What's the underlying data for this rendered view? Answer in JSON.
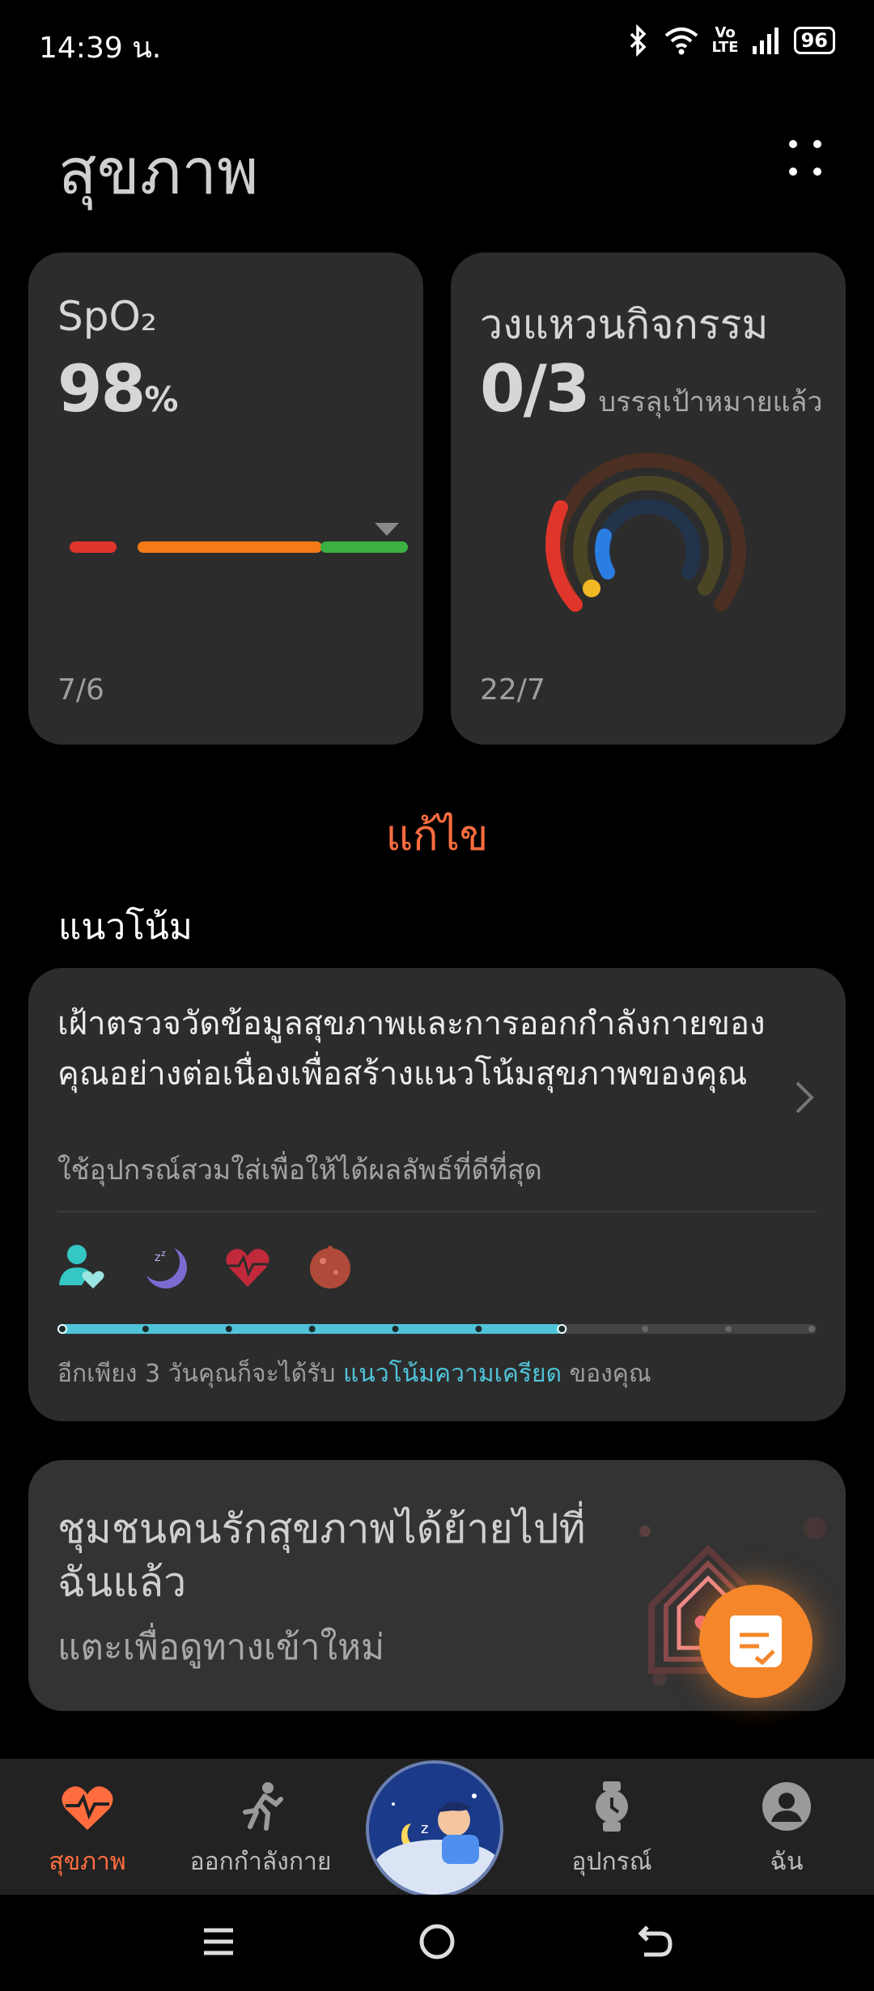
{
  "status": {
    "time": "14:39 น.",
    "battery": "96",
    "volte_top": "Vo",
    "volte_bottom": "LTE"
  },
  "page": {
    "title": "สุขภาพ"
  },
  "cards": {
    "spo2": {
      "label": "SpO₂",
      "value": "98",
      "unit": "%",
      "date": "7/6"
    },
    "ring": {
      "label": "วงแหวนกิจกรรม",
      "value": "0/3",
      "sub": "บรรลุเป้าหมายแล้ว",
      "date": "22/7"
    }
  },
  "edit": {
    "label": "แก้ไข"
  },
  "trends": {
    "section_title": "แนวโน้ม",
    "main": "เฝ้าตรวจวัดข้อมูลสุขภาพและการออกกำลังกายของคุณอย่างต่อเนื่องเพื่อสร้างแนวโน้มสุขภาพของคุณ",
    "hint": "ใช้อุปกรณ์สวมใส่เพื่อให้ได้ผลลัพธ์ที่ดีที่สุด",
    "progress_completed": 6,
    "progress_total": 9,
    "note_pre": "อีกเพียง 3 วันคุณก็จะได้รับ ",
    "note_link": "แนวโน้มความเครียด",
    "note_post": " ของคุณ",
    "icons": [
      "person-heart-icon",
      "sleep-moon-icon",
      "heart-rate-icon",
      "stress-icon"
    ]
  },
  "community": {
    "title": "ชุมชนคนรักสุขภาพได้ย้ายไปที่ฉันแล้ว",
    "sub": "แตะเพื่อดูทางเข้าใหม่"
  },
  "nav": [
    {
      "label": "สุขภาพ",
      "icon": "heart-pulse-icon",
      "active": true
    },
    {
      "label": "ออกกำลังกาย",
      "icon": "running-icon",
      "active": false
    },
    {
      "label": "",
      "icon": "sleep-center-icon",
      "active": false
    },
    {
      "label": "อุปกรณ์",
      "icon": "watch-icon",
      "active": false
    },
    {
      "label": "ฉัน",
      "icon": "profile-icon",
      "active": false
    }
  ],
  "colors": {
    "accent": "#ff6d3f",
    "teal": "#4fc3d8",
    "card": "#2c2c2c"
  }
}
